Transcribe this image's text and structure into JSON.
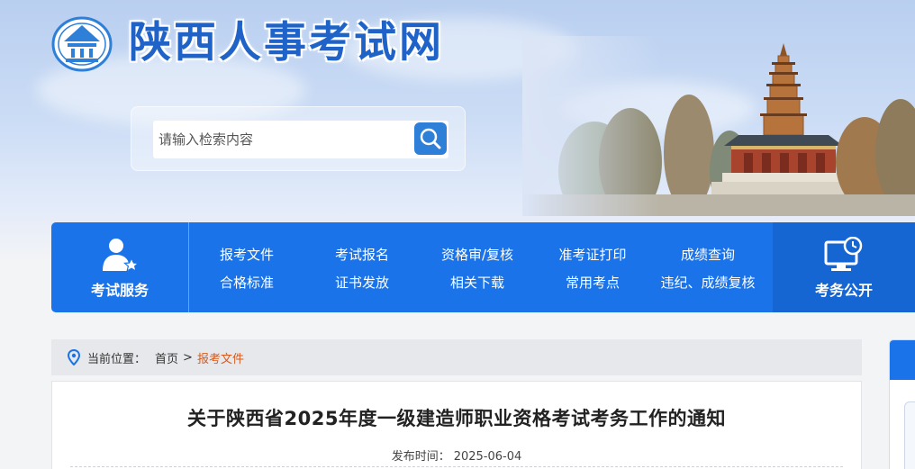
{
  "site": {
    "title": "陕西人事考试网"
  },
  "search": {
    "placeholder": "请输入检索内容",
    "icon": "search-icon"
  },
  "nav": {
    "service_label": "考试服务",
    "public_label": "考务公开",
    "links_row1": [
      "报考文件",
      "考试报名",
      "资格审/复核",
      "准考证打印",
      "成绩查询"
    ],
    "links_row2": [
      "合格标准",
      "证书发放",
      "相关下载",
      "常用考点",
      "违纪、成绩复核"
    ]
  },
  "breadcrumb": {
    "prefix": "当前位置：",
    "home": "首页",
    "separator": ">",
    "current": "报考文件"
  },
  "article": {
    "title": "关于陕西省2025年度一级建造师职业资格考试考务工作的通知",
    "date_label": "发布时间：",
    "date": "2025-06-04"
  },
  "colors": {
    "primary": "#1a73e8",
    "title_blue": "#1f63c9",
    "accent_orange": "#d9591a"
  }
}
